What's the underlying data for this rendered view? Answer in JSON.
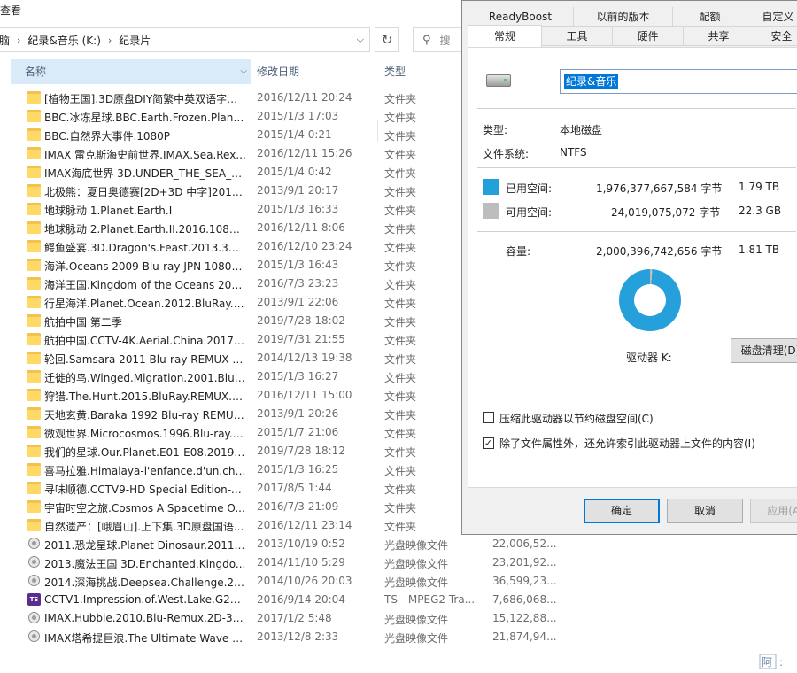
{
  "explorer": {
    "menu_view": "查看",
    "address": {
      "crumb0": "脑",
      "crumb1": "纪录&音乐 (K:)",
      "crumb2": "纪录片"
    },
    "search_placeholder": "搜",
    "columns": {
      "name": "名称",
      "date": "修改日期",
      "type": "类型"
    },
    "rows": [
      {
        "icon": "folder",
        "name": "[植物王国].3D原盘DIY简繁中英双语字幕...",
        "date": "2016/12/11 20:24",
        "type": "文件夹",
        "size": ""
      },
      {
        "icon": "folder",
        "name": "BBC.冰冻星球.BBC.Earth.Frozen.Planet...",
        "date": "2015/1/3 17:03",
        "type": "文件夹",
        "size": ""
      },
      {
        "icon": "folder",
        "name": "BBC.自然界大事件.1080P",
        "date": "2015/1/4 0:21",
        "type": "文件夹",
        "size": ""
      },
      {
        "icon": "folder",
        "name": "IMAX 雷克斯海史前世界.IMAX.Sea.Rex...",
        "date": "2016/12/11 15:26",
        "type": "文件夹",
        "size": ""
      },
      {
        "icon": "folder",
        "name": "IMAX海底世界 3D.UNDER_THE_SEA_3...",
        "date": "2015/1/4 0:42",
        "type": "文件夹",
        "size": ""
      },
      {
        "icon": "folder",
        "name": "北极熊：夏日奥德赛[2D+3D 中字]2012...",
        "date": "2013/9/1 20:17",
        "type": "文件夹",
        "size": ""
      },
      {
        "icon": "folder",
        "name": "地球脉动 1.Planet.Earth.I",
        "date": "2015/1/3 16:33",
        "type": "文件夹",
        "size": ""
      },
      {
        "icon": "folder",
        "name": "地球脉动 2.Planet.Earth.II.2016.1080p...",
        "date": "2016/12/11 8:06",
        "type": "文件夹",
        "size": ""
      },
      {
        "icon": "folder",
        "name": "鳄鱼盛宴.3D.Dragon's.Feast.2013.3D.B...",
        "date": "2016/12/10 23:24",
        "type": "文件夹",
        "size": ""
      },
      {
        "icon": "folder",
        "name": "海洋.Oceans 2009 Blu-ray JPN 1080p ...",
        "date": "2015/1/3 16:43",
        "type": "文件夹",
        "size": ""
      },
      {
        "icon": "folder",
        "name": "海洋王国.Kingdom of the Oceans 201...",
        "date": "2016/7/3 23:23",
        "type": "文件夹",
        "size": ""
      },
      {
        "icon": "folder",
        "name": "行星海洋.Planet.Ocean.2012.BluRay.10...",
        "date": "2013/9/1 22:06",
        "type": "文件夹",
        "size": ""
      },
      {
        "icon": "folder",
        "name": "航拍中国 第二季",
        "date": "2019/7/28 18:02",
        "type": "文件夹",
        "size": ""
      },
      {
        "icon": "folder",
        "name": "航拍中国.CCTV-4K.Aerial.China.2017.C...",
        "date": "2019/7/31 21:55",
        "type": "文件夹",
        "size": ""
      },
      {
        "icon": "folder",
        "name": "轮回.Samsara 2011 Blu-ray REMUX 1...",
        "date": "2014/12/13 19:38",
        "type": "文件夹",
        "size": ""
      },
      {
        "icon": "folder",
        "name": "迁徙的鸟.Winged.Migration.2001.Blu-...",
        "date": "2015/1/3 16:27",
        "type": "文件夹",
        "size": ""
      },
      {
        "icon": "folder",
        "name": "狩猎.The.Hunt.2015.BluRay.REMUX.10...",
        "date": "2016/12/11 15:00",
        "type": "文件夹",
        "size": ""
      },
      {
        "icon": "folder",
        "name": "天地玄黄.Baraka 1992 Blu-ray REMUX...",
        "date": "2013/9/1 20:26",
        "type": "文件夹",
        "size": ""
      },
      {
        "icon": "folder",
        "name": "微观世界.Microcosmos.1996.Blu-ray.1...",
        "date": "2015/1/7 21:06",
        "type": "文件夹",
        "size": ""
      },
      {
        "icon": "folder",
        "name": "我们的星球.Our.Planet.E01-E08.2019.1...",
        "date": "2019/7/28 18:12",
        "type": "文件夹",
        "size": ""
      },
      {
        "icon": "folder",
        "name": "喜马拉雅.Himalaya-l'enfance.d'un.chef...",
        "date": "2015/1/3 16:25",
        "type": "文件夹",
        "size": ""
      },
      {
        "icon": "folder",
        "name": "寻味顺德.CCTV9-HD Special Edition-A...",
        "date": "2017/8/5 1:44",
        "type": "文件夹",
        "size": ""
      },
      {
        "icon": "folder",
        "name": "宇宙时空之旅.Cosmos A Spacetime O...",
        "date": "2016/7/3 21:09",
        "type": "文件夹",
        "size": ""
      },
      {
        "icon": "folder",
        "name": "自然遗产：[峨眉山].上下集.3D原盘国语...",
        "date": "2016/12/11 23:14",
        "type": "文件夹",
        "size": ""
      },
      {
        "icon": "disc",
        "name": "2011.恐龙星球.Planet Dinosaur.2011.B...",
        "date": "2013/10/19 0:52",
        "type": "光盘映像文件",
        "size": "22,006,52..."
      },
      {
        "icon": "disc",
        "name": "2013.魔法王国 3D.Enchanted.Kingdo...",
        "date": "2014/11/10 5:29",
        "type": "光盘映像文件",
        "size": "23,201,92..."
      },
      {
        "icon": "disc",
        "name": "2014.深海挑战.Deepsea.Challenge.201...",
        "date": "2014/10/26 20:03",
        "type": "光盘映像文件",
        "size": "36,599,23..."
      },
      {
        "icon": "ts",
        "name": "CCTV1.Impression.of.West.Lake.G20....",
        "date": "2016/9/14 20:04",
        "type": "TS - MPEG2 Tra...",
        "size": "7,686,068..."
      },
      {
        "icon": "disc",
        "name": "IMAX.Hubble.2010.Blu-Remux.2D-3D....",
        "date": "2017/1/2 5:48",
        "type": "光盘映像文件",
        "size": "15,122,88..."
      },
      {
        "icon": "disc",
        "name": "IMAX塔希提巨浪.The Ultimate Wave T...",
        "date": "2013/12/8 2:33",
        "type": "光盘映像文件",
        "size": "21,874,94..."
      }
    ]
  },
  "dialog": {
    "tabs_top": [
      "ReadyBoost",
      "以前的版本",
      "配额",
      "自定义"
    ],
    "tabs_bottom": [
      "常规",
      "工具",
      "硬件",
      "共享",
      "安全"
    ],
    "volume_name": "纪录&音乐",
    "type_label": "类型:",
    "type_value": "本地磁盘",
    "fs_label": "文件系统:",
    "fs_value": "NTFS",
    "used_label": "已用空间:",
    "used_bytes": "1,976,377,667,584 字节",
    "used_h": "1.79 TB",
    "free_label": "可用空间:",
    "free_bytes": "24,019,075,072 字节",
    "free_h": "22.3 GB",
    "cap_label": "容量:",
    "cap_bytes": "2,000,396,742,656 字节",
    "cap_h": "1.81 TB",
    "used_fraction": 0.988,
    "colors": {
      "used": "#26a0da",
      "free": "#bdbdbd"
    },
    "drive_label": "驱动器 K:",
    "cleanup_btn": "磁盘清理(D)",
    "compress_label": "压缩此驱动器以节约磁盘空间(C)",
    "index_label": "除了文件属性外，还允许索引此驱动器上文件的内容(I)",
    "ok": "确定",
    "cancel": "取消",
    "apply": "应用(A)"
  },
  "watermark": "阿:"
}
